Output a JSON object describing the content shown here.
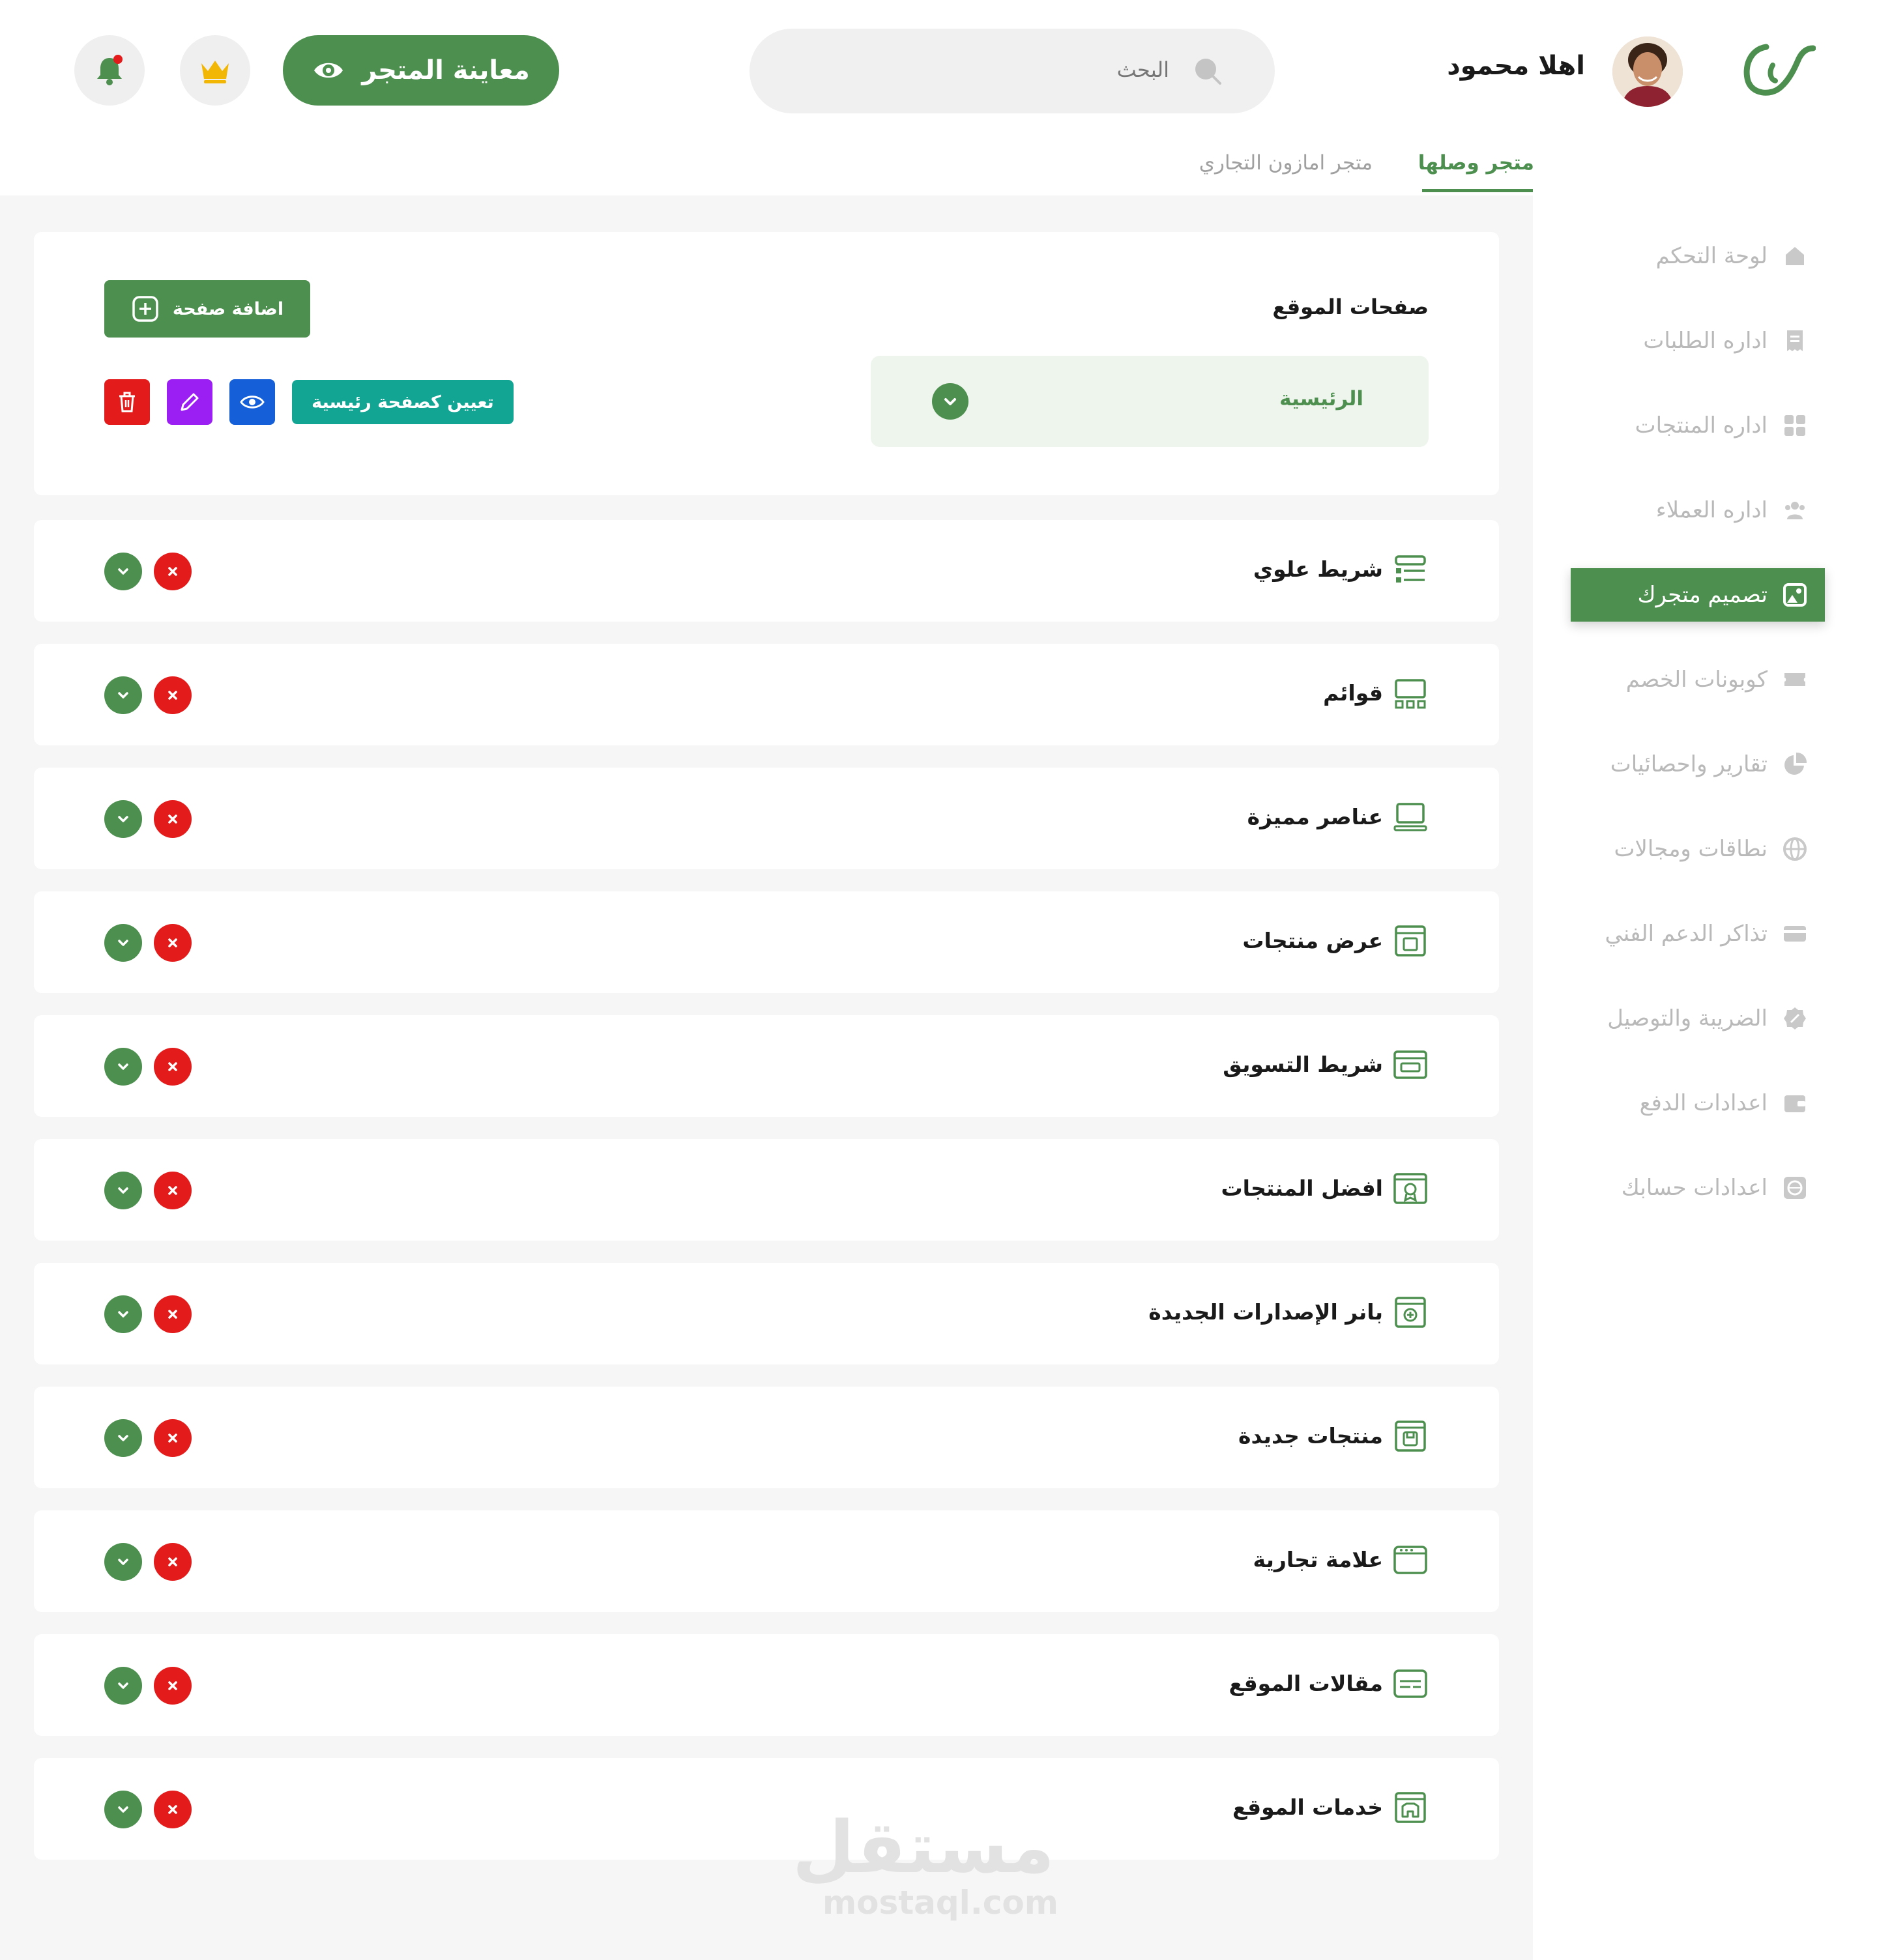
{
  "colors": {
    "brand_green": "#4d8f4f",
    "danger_red": "#e41b1b",
    "teal": "#12a594",
    "edit_purple": "#9b1ff2",
    "view_blue": "#1560d8",
    "page_bg": "#f6f6f6"
  },
  "header": {
    "greeting": "اهلا محمود",
    "search": {
      "placeholder": "البحث"
    },
    "preview_label": "معاينة المتجر",
    "icons": {
      "logo": "brand-logo",
      "search": "search-icon",
      "preview": "eye-icon",
      "premium": "crown-icon",
      "notifications": "bell-icon"
    }
  },
  "store_tabs": [
    {
      "label": "متجر وصلها",
      "active": true
    },
    {
      "label": "متجر امازون التجاري",
      "active": false
    }
  ],
  "sidebar": {
    "items": [
      {
        "label": "لوحة التحكم",
        "icon": "home-icon",
        "active": false
      },
      {
        "label": "اداره الطلبات",
        "icon": "receipt-icon",
        "active": false
      },
      {
        "label": "اداره المنتجات",
        "icon": "grid-icon",
        "active": false
      },
      {
        "label": "اداره العملاء",
        "icon": "users-icon",
        "active": false
      },
      {
        "label": "تصميم متجرك",
        "icon": "image-icon",
        "active": true
      },
      {
        "label": "كوبونات الخصم",
        "icon": "ticket-icon",
        "active": false
      },
      {
        "label": "تقارير واحصائيات",
        "icon": "pie-chart-icon",
        "active": false
      },
      {
        "label": "نطاقات ومجالات",
        "icon": "globe-icon",
        "active": false
      },
      {
        "label": "تذاكر الدعم الفني",
        "icon": "card-icon",
        "active": false
      },
      {
        "label": "الضريبة والتوصيل",
        "icon": "discount-badge-icon",
        "active": false
      },
      {
        "label": "اعدادات الدفع",
        "icon": "wallet-icon",
        "active": false
      },
      {
        "label": "اعدادات حسابك",
        "icon": "settings-globe-icon",
        "active": false
      }
    ]
  },
  "pages_card": {
    "title": "صفحات الموقع",
    "selected_page": "الرئيسية",
    "add_page_label": "اضافة صفحة",
    "set_home_label": "تعيين كصفحة رئيسية",
    "icons": {
      "add": "plus-square-icon",
      "view": "eye-icon",
      "edit": "pencil-icon",
      "delete": "trash-icon",
      "dropdown": "chevron-down-icon"
    }
  },
  "sections": [
    {
      "label": "شريط علوي",
      "icon": "top-bar-icon"
    },
    {
      "label": "قوائم",
      "icon": "menus-icon"
    },
    {
      "label": "عناصر مميزة",
      "icon": "featured-items-icon"
    },
    {
      "label": "عرض منتجات",
      "icon": "product-display-icon"
    },
    {
      "label": "شريط التسويق",
      "icon": "marketing-bar-icon"
    },
    {
      "label": "افضل المنتجات",
      "icon": "award-icon"
    },
    {
      "label": "بانر الإصدارات الجديدة",
      "icon": "new-releases-banner-icon"
    },
    {
      "label": "منتجات جديدة",
      "icon": "new-products-icon"
    },
    {
      "label": "علامة تجارية",
      "icon": "brand-window-icon"
    },
    {
      "label": "مقالات الموقع",
      "icon": "articles-icon"
    },
    {
      "label": "خدمات الموقع",
      "icon": "services-icon"
    }
  ],
  "watermark": {
    "arabic": "مستقل",
    "latin": "mostaql.com"
  }
}
